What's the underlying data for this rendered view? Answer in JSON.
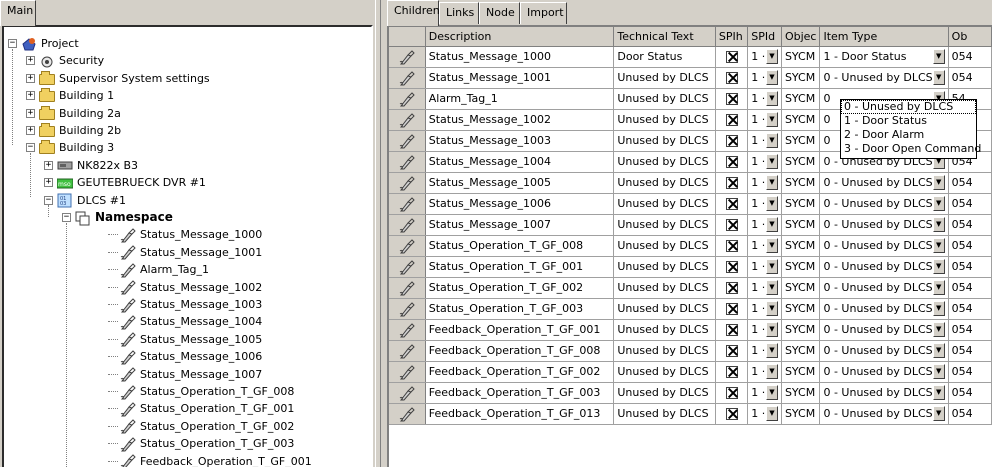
{
  "left_tabs": [
    "Main"
  ],
  "tree": {
    "items": [
      {
        "label": "Project",
        "level": 0,
        "expander": "−",
        "icon": "project-icon"
      },
      {
        "label": "Security",
        "level": 1,
        "expander": "+",
        "icon": "security-icon"
      },
      {
        "label": "Supervisor System settings",
        "level": 1,
        "expander": "+",
        "icon": "folder-icon"
      },
      {
        "label": "Building 1",
        "level": 1,
        "expander": "+",
        "icon": "folder-icon"
      },
      {
        "label": "Building 2a",
        "level": 1,
        "expander": "+",
        "icon": "folder-icon"
      },
      {
        "label": "Building 2b",
        "level": 1,
        "expander": "+",
        "icon": "folder-icon"
      },
      {
        "label": "Building 3",
        "level": 1,
        "expander": "−",
        "icon": "folder-icon"
      },
      {
        "label": "NK822x B3",
        "level": 2,
        "expander": "+",
        "icon": "device-icon"
      },
      {
        "label": "GEUTEBRUECK DVR #1",
        "level": 2,
        "expander": "+",
        "icon": "dvr-icon"
      },
      {
        "label": "DLCS #1",
        "level": 2,
        "expander": "−",
        "icon": "dlcs-icon"
      },
      {
        "label": "Namespace",
        "level": 3,
        "expander": "−",
        "icon": "namespace-icon"
      },
      {
        "label": "Status_Message_1000",
        "level": 4,
        "icon": "probe-icon"
      },
      {
        "label": "Status_Message_1001",
        "level": 4,
        "icon": "probe-icon"
      },
      {
        "label": "Alarm_Tag_1",
        "level": 4,
        "icon": "probe-icon"
      },
      {
        "label": "Status_Message_1002",
        "level": 4,
        "icon": "probe-icon"
      },
      {
        "label": "Status_Message_1003",
        "level": 4,
        "icon": "probe-icon"
      },
      {
        "label": "Status_Message_1004",
        "level": 4,
        "icon": "probe-icon"
      },
      {
        "label": "Status_Message_1005",
        "level": 4,
        "icon": "probe-icon"
      },
      {
        "label": "Status_Message_1006",
        "level": 4,
        "icon": "probe-icon"
      },
      {
        "label": "Status_Message_1007",
        "level": 4,
        "icon": "probe-icon"
      },
      {
        "label": "Status_Operation_T_GF_008",
        "level": 4,
        "icon": "probe-icon"
      },
      {
        "label": "Status_Operation_T_GF_001",
        "level": 4,
        "icon": "probe-icon"
      },
      {
        "label": "Status_Operation_T_GF_002",
        "level": 4,
        "icon": "probe-icon"
      },
      {
        "label": "Status_Operation_T_GF_003",
        "level": 4,
        "icon": "probe-icon"
      },
      {
        "label": "Feedback_Operation_T_GF_001",
        "level": 4,
        "icon": "probe-icon"
      }
    ]
  },
  "right_tabs": [
    "Children",
    "Links",
    "Node",
    "Import"
  ],
  "grid": {
    "columns": [
      "Description",
      "Technical Text",
      "SPIh",
      "SPId",
      "Objec",
      "Item Type",
      "Ob"
    ],
    "rows": [
      {
        "description": "Status_Message_1000",
        "technical_text": "Door Status",
        "spid": "1 ·",
        "object": "SYCM",
        "item_type": "1 - Door Status",
        "ob": "054"
      },
      {
        "description": "Status_Message_1001",
        "technical_text": "Unused by DLCS",
        "spid": "1 ·",
        "object": "SYCM",
        "item_type": "0 - Unused by DLCS",
        "ob": "054"
      },
      {
        "description": "Alarm_Tag_1",
        "technical_text": "Unused by DLCS",
        "spid": "1 ·",
        "object": "SYCM",
        "item_type": "0",
        "ob": "54"
      },
      {
        "description": "Status_Message_1002",
        "technical_text": "Unused by DLCS",
        "spid": "1 ·",
        "object": "SYCM",
        "item_type": "0",
        "ob": "54"
      },
      {
        "description": "Status_Message_1003",
        "technical_text": "Unused by DLCS",
        "spid": "1 ·",
        "object": "SYCM",
        "item_type": "0",
        "ob": "54"
      },
      {
        "description": "Status_Message_1004",
        "technical_text": "Unused by DLCS",
        "spid": "1 ·",
        "object": "SYCM",
        "item_type": "0 - Unused by DLCS",
        "ob": "054"
      },
      {
        "description": "Status_Message_1005",
        "technical_text": "Unused by DLCS",
        "spid": "1 ·",
        "object": "SYCM",
        "item_type": "0 - Unused by DLCS",
        "ob": "054"
      },
      {
        "description": "Status_Message_1006",
        "technical_text": "Unused by DLCS",
        "spid": "1 ·",
        "object": "SYCM",
        "item_type": "0 - Unused by DLCS",
        "ob": "054"
      },
      {
        "description": "Status_Message_1007",
        "technical_text": "Unused by DLCS",
        "spid": "1 ·",
        "object": "SYCM",
        "item_type": "0 - Unused by DLCS",
        "ob": "054"
      },
      {
        "description": "Status_Operation_T_GF_008",
        "technical_text": "Unused by DLCS",
        "spid": "1 ·",
        "object": "SYCM",
        "item_type": "0 - Unused by DLCS",
        "ob": "054"
      },
      {
        "description": "Status_Operation_T_GF_001",
        "technical_text": "Unused by DLCS",
        "spid": "1 ·",
        "object": "SYCM",
        "item_type": "0 - Unused by DLCS",
        "ob": "054"
      },
      {
        "description": "Status_Operation_T_GF_002",
        "technical_text": "Unused by DLCS",
        "spid": "1 ·",
        "object": "SYCM",
        "item_type": "0 - Unused by DLCS",
        "ob": "054"
      },
      {
        "description": "Status_Operation_T_GF_003",
        "technical_text": "Unused by DLCS",
        "spid": "1 ·",
        "object": "SYCM",
        "item_type": "0 - Unused by DLCS",
        "ob": "054"
      },
      {
        "description": "Feedback_Operation_T_GF_001",
        "technical_text": "Unused by DLCS",
        "spid": "1 ·",
        "object": "SYCM",
        "item_type": "0 - Unused by DLCS",
        "ob": "054"
      },
      {
        "description": "Feedback_Operation_T_GF_008",
        "technical_text": "Unused by DLCS",
        "spid": "1 ·",
        "object": "SYCM",
        "item_type": "0 - Unused by DLCS",
        "ob": "054"
      },
      {
        "description": "Feedback_Operation_T_GF_002",
        "technical_text": "Unused by DLCS",
        "spid": "1 ·",
        "object": "SYCM",
        "item_type": "0 - Unused by DLCS",
        "ob": "054"
      },
      {
        "description": "Feedback_Operation_T_GF_003",
        "technical_text": "Unused by DLCS",
        "spid": "1 ·",
        "object": "SYCM",
        "item_type": "0 - Unused by DLCS",
        "ob": "054"
      },
      {
        "description": "Feedback_Operation_T_GF_013",
        "technical_text": "Unused by DLCS",
        "spid": "1 ·",
        "object": "SYCM",
        "item_type": "0 - Unused by DLCS",
        "ob": "054"
      }
    ]
  },
  "dropdown": {
    "options": [
      "0 - Unused by DLCS",
      "1 - Door Status",
      "2 - Door Alarm",
      "3 - Door Open Command"
    ],
    "selected_index": 0
  },
  "colors": {
    "window": "#d4d0c8",
    "grid_bg": "#ffffff",
    "accent_folder": "#f0d060"
  }
}
